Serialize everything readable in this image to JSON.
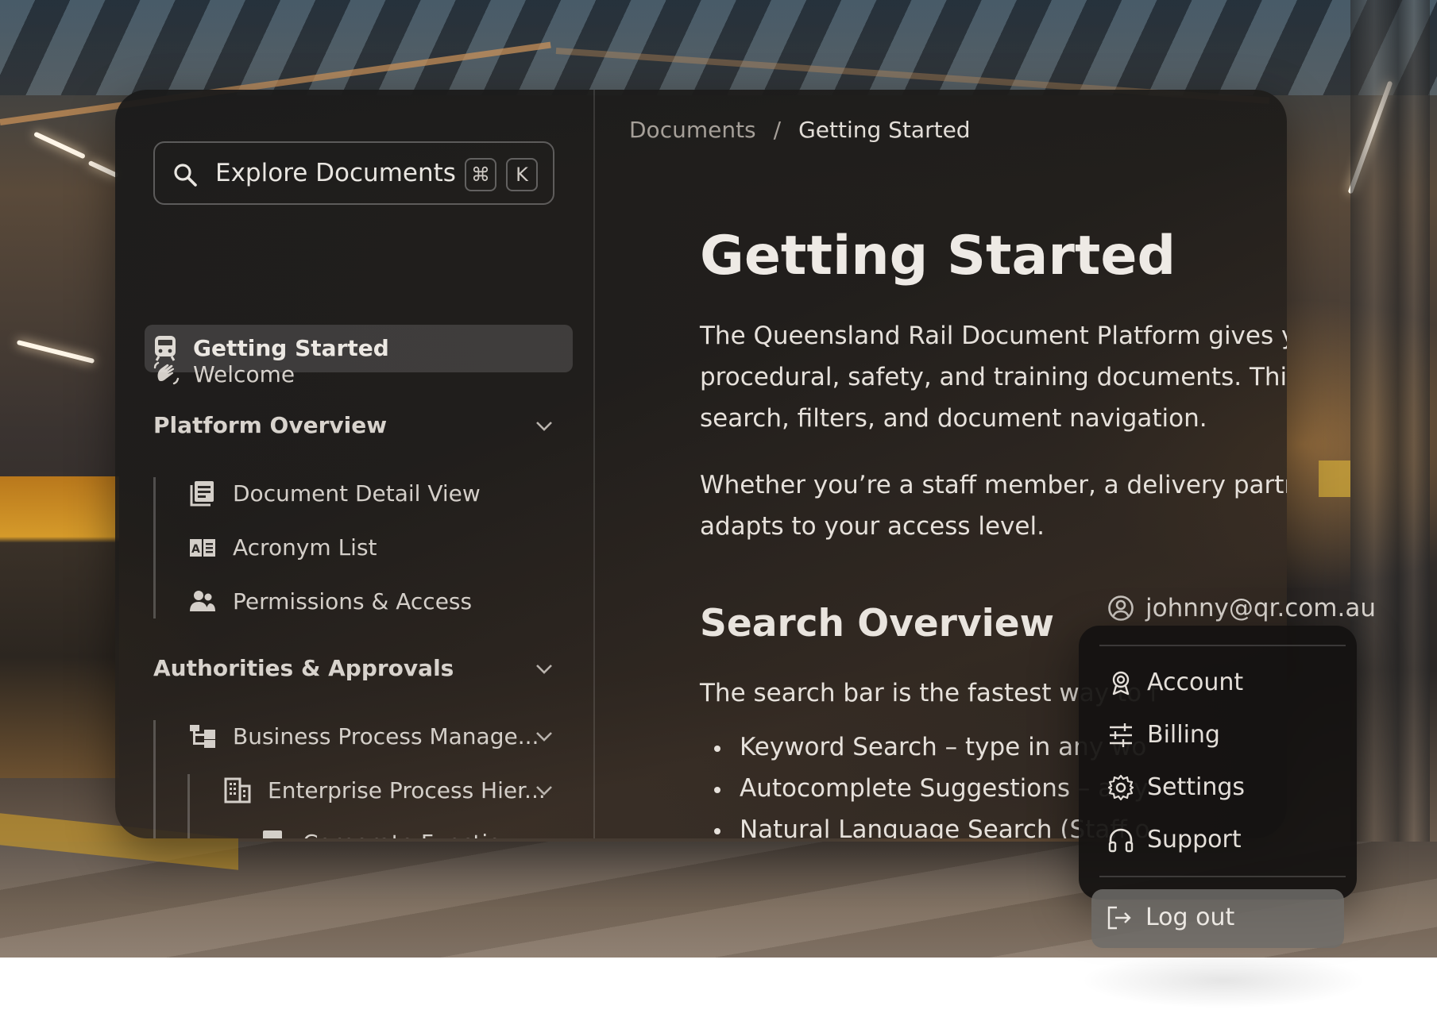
{
  "search": {
    "placeholder": "Explore Documents",
    "shortcut_mod": "⌘",
    "shortcut_key": "K"
  },
  "sidebar": {
    "items": [
      {
        "label": "Welcome",
        "icon": "waving-hand-icon"
      },
      {
        "label": "Getting Started",
        "icon": "train-icon",
        "active": true
      }
    ],
    "sections": [
      {
        "title": "Platform Overview",
        "items": [
          {
            "label": "Document Detail View",
            "icon": "document-list-icon"
          },
          {
            "label": "Acronym List",
            "icon": "book-icon"
          },
          {
            "label": "Permissions & Access",
            "icon": "users-icon"
          }
        ]
      },
      {
        "title": "Authorities & Approvals",
        "items": [
          {
            "label": "Business Process Manage...",
            "icon": "hierarchy-icon"
          },
          {
            "label": "Enterprise Process Hier...",
            "icon": "building-icon"
          },
          {
            "label": "Corporate Functio...",
            "icon": "document-icon"
          }
        ]
      }
    ]
  },
  "breadcrumb": {
    "parent": "Documents",
    "separator": "/",
    "current": "Getting Started"
  },
  "article": {
    "title": "Getting Started",
    "intro_lines": [
      "The Queensland Rail Document Platform gives you secu",
      "procedural, safety, and training documents. This guide",
      "search, filters, and document navigation."
    ],
    "access_lines": [
      "Whether you’re a staff member, a delivery partner, or a",
      "adapts to your access level."
    ],
    "section_title": "Search Overview",
    "search_intro": "The search bar is the fastest way to f",
    "bullets": [
      "Keyword Search – type in any wo",
      "Autocomplete Suggestions – as y",
      "Natural Language Search (Staff o"
    ]
  },
  "account": {
    "email": "johnny@qr.com.au",
    "menu": [
      {
        "label": "Account",
        "icon": "badge-icon"
      },
      {
        "label": "Billing",
        "icon": "sliders-icon"
      },
      {
        "label": "Settings",
        "icon": "gear-icon"
      },
      {
        "label": "Support",
        "icon": "headphones-icon"
      }
    ],
    "logout": {
      "label": "Log out",
      "icon": "logout-icon"
    }
  }
}
